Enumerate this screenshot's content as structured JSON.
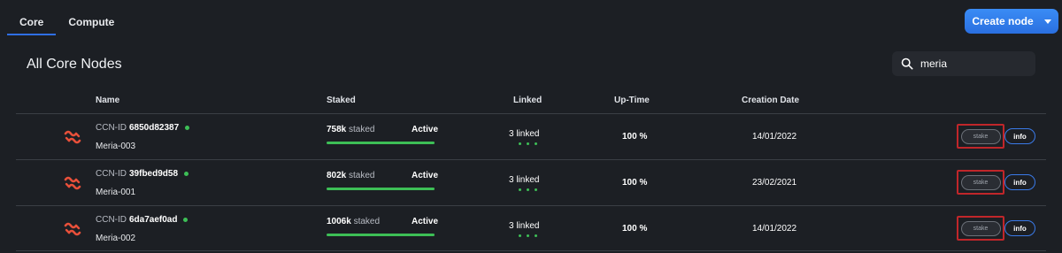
{
  "tabs": [
    {
      "label": "Core",
      "active": true
    },
    {
      "label": "Compute",
      "active": false
    }
  ],
  "create_button": {
    "label": "Create node"
  },
  "page_title": "All Core Nodes",
  "search": {
    "value": "meria"
  },
  "columns": {
    "name": "Name",
    "staked": "Staked",
    "linked": "Linked",
    "uptime": "Up-Time",
    "creation_date": "Creation Date"
  },
  "rows": [
    {
      "ccn_prefix": "CCN-ID",
      "id": "6850d82387",
      "name": "Meria-003",
      "staked_amount": "758k",
      "staked_suffix": "staked",
      "status": "Active",
      "progress": 1.0,
      "linked": "3 linked",
      "uptime": "100 %",
      "date": "14/01/2022",
      "stake_label": "stake",
      "info_label": "info"
    },
    {
      "ccn_prefix": "CCN-ID",
      "id": "39fbed9d58",
      "name": "Meria-001",
      "staked_amount": "802k",
      "staked_suffix": "staked",
      "status": "Active",
      "progress": 1.0,
      "linked": "3 linked",
      "uptime": "100 %",
      "date": "23/02/2021",
      "stake_label": "stake",
      "info_label": "info"
    },
    {
      "ccn_prefix": "CCN-ID",
      "id": "6da7aef0ad",
      "name": "Meria-002",
      "staked_amount": "1006k",
      "staked_suffix": "staked",
      "status": "Active",
      "progress": 1.0,
      "linked": "3 linked",
      "uptime": "100 %",
      "date": "14/01/2022",
      "stake_label": "stake",
      "info_label": "info"
    }
  ],
  "colors": {
    "accent": "#2f6fe4",
    "online": "#3dbf56",
    "logo": "#e8503a",
    "highlight": "#c0262a"
  }
}
